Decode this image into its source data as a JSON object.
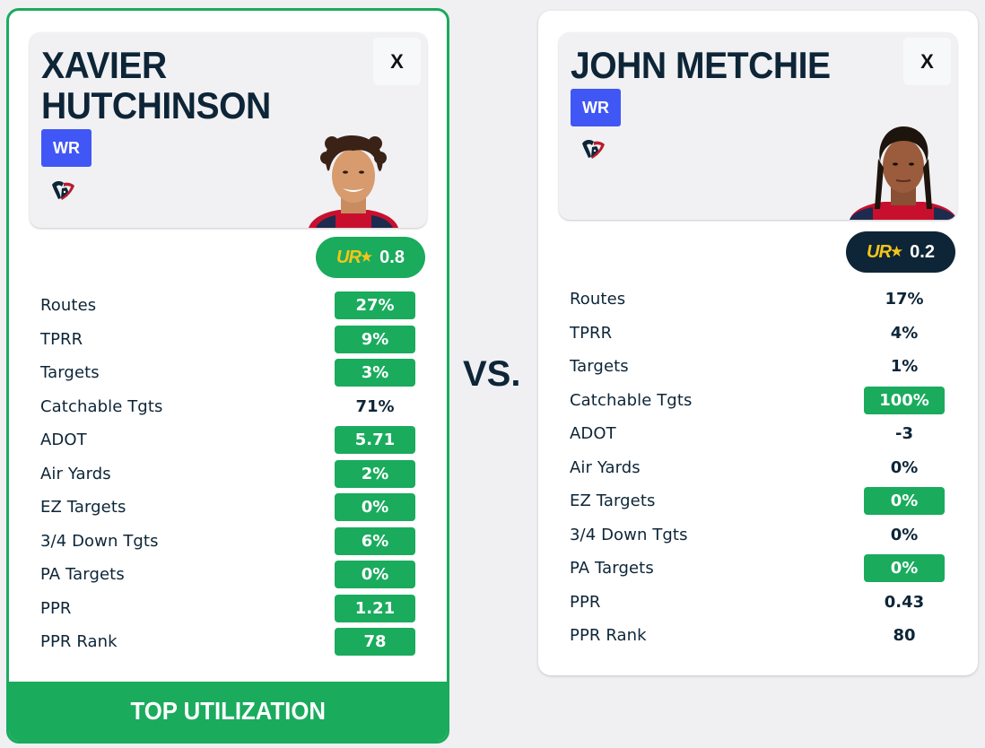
{
  "vs_label": "VS.",
  "colors": {
    "highlight": "#1aab5d",
    "navy": "#0d2537",
    "position_badge": "#4057f6",
    "ur_star": "#f5c518"
  },
  "players": [
    {
      "name": "Xavier Hutchinson",
      "position": "WR",
      "team_logo_icon": "houston-texans-logo",
      "close_label": "X",
      "ur_logo_text": "UR",
      "ur_score": "0.8",
      "ur_pill_highlight": true,
      "stats": [
        {
          "label": "Routes",
          "value": "27%",
          "highlight": true
        },
        {
          "label": "TPRR",
          "value": "9%",
          "highlight": true
        },
        {
          "label": "Targets",
          "value": "3%",
          "highlight": true
        },
        {
          "label": "Catchable Tgts",
          "value": "71%",
          "highlight": false
        },
        {
          "label": "ADOT",
          "value": "5.71",
          "highlight": true
        },
        {
          "label": "Air Yards",
          "value": "2%",
          "highlight": true
        },
        {
          "label": "EZ Targets",
          "value": "0%",
          "highlight": true
        },
        {
          "label": "3/4 Down Tgts",
          "value": "6%",
          "highlight": true
        },
        {
          "label": "PA Targets",
          "value": "0%",
          "highlight": true
        },
        {
          "label": "PPR",
          "value": "1.21",
          "highlight": true
        },
        {
          "label": "PPR Rank",
          "value": "78",
          "highlight": true
        }
      ],
      "banner": "TOP UTILIZATION"
    },
    {
      "name": "John Metchie",
      "position": "WR",
      "team_logo_icon": "houston-texans-logo",
      "close_label": "X",
      "ur_logo_text": "UR",
      "ur_score": "0.2",
      "ur_pill_highlight": false,
      "stats": [
        {
          "label": "Routes",
          "value": "17%",
          "highlight": false
        },
        {
          "label": "TPRR",
          "value": "4%",
          "highlight": false
        },
        {
          "label": "Targets",
          "value": "1%",
          "highlight": false
        },
        {
          "label": "Catchable Tgts",
          "value": "100%",
          "highlight": true
        },
        {
          "label": "ADOT",
          "value": "-3",
          "highlight": false
        },
        {
          "label": "Air Yards",
          "value": "0%",
          "highlight": false
        },
        {
          "label": "EZ Targets",
          "value": "0%",
          "highlight": true
        },
        {
          "label": "3/4 Down Tgts",
          "value": "0%",
          "highlight": false
        },
        {
          "label": "PA Targets",
          "value": "0%",
          "highlight": true
        },
        {
          "label": "PPR",
          "value": "0.43",
          "highlight": false
        },
        {
          "label": "PPR Rank",
          "value": "80",
          "highlight": false
        }
      ]
    }
  ]
}
